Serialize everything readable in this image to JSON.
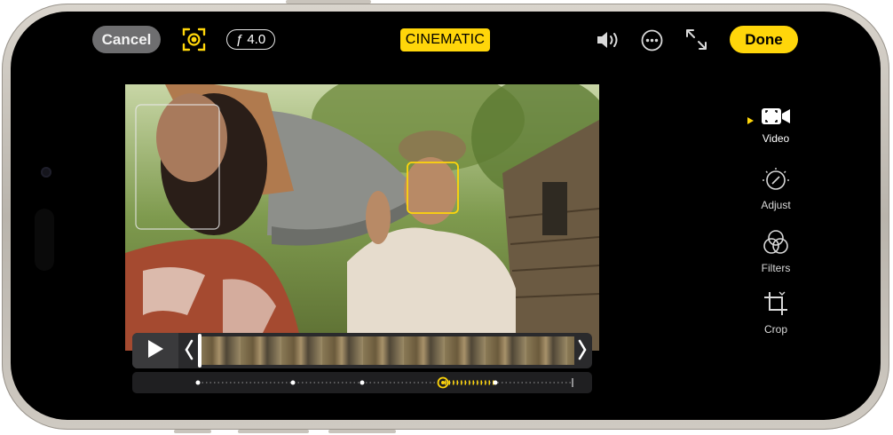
{
  "header": {
    "cancel_label": "Cancel",
    "aperture_label": "ƒ 4.0",
    "mode_label": "CINEMATIC",
    "done_label": "Done"
  },
  "icons": {
    "focus": "focus-tracking-icon",
    "volume": "speaker-icon",
    "more": "more-ellipsis-icon",
    "aspect": "expand-arrows-icon",
    "play": "play-icon"
  },
  "tools": [
    {
      "label": "Video",
      "icon": "video-icon",
      "active": true
    },
    {
      "label": "Adjust",
      "icon": "adjust-icon",
      "active": false
    },
    {
      "label": "Filters",
      "icon": "filters-icon",
      "active": false
    },
    {
      "label": "Crop",
      "icon": "crop-icon",
      "active": false
    }
  ],
  "colors": {
    "accent": "#ffd60a",
    "button_gray": "#6e6e70",
    "screen": "#000000"
  }
}
